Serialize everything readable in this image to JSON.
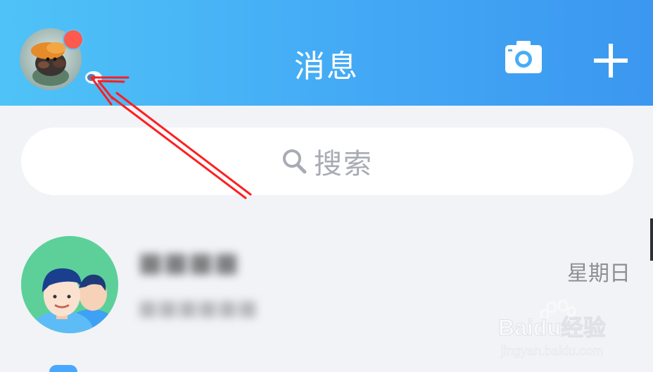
{
  "header": {
    "title": "消息",
    "camera_icon": "camera-icon",
    "add_icon": "plus-icon"
  },
  "search": {
    "placeholder": "搜索",
    "icon": "search-icon"
  },
  "conversations": [
    {
      "time": "星期日"
    }
  ],
  "watermark": {
    "text": "Baidu经验",
    "url_text": "jingyan.baidu.com"
  },
  "colors": {
    "header_start": "#4fc3f7",
    "header_end": "#3b97f0",
    "unread_dot": "#ff5a4e",
    "arrow": "#ff1f1f"
  }
}
